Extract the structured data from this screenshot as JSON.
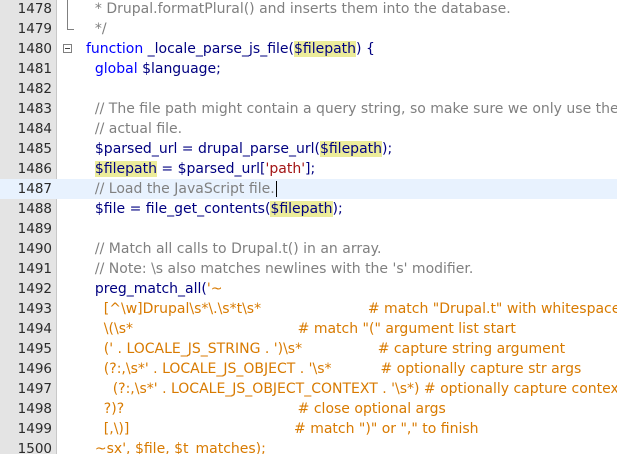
{
  "lines": [
    {
      "num": "1478",
      "tokens": [
        {
          "t": "  * Drupal.formatPlural() and inserts them into the database.",
          "c": "t-cmt"
        }
      ]
    },
    {
      "num": "1479",
      "tokens": [
        {
          "t": "  */",
          "c": "t-cmt"
        }
      ]
    },
    {
      "num": "1480",
      "tokens": [
        {
          "t": "function",
          "c": "t-kw"
        },
        {
          "t": " _locale_parse_js_file(",
          "c": "t-fn"
        },
        {
          "t": "$filepath",
          "c": "t-hl"
        },
        {
          "t": ") {",
          "c": "t-fn"
        }
      ]
    },
    {
      "num": "1481",
      "tokens": [
        {
          "t": "  global ",
          "c": "t-kw"
        },
        {
          "t": "$language;",
          "c": "t-var"
        }
      ]
    },
    {
      "num": "1482",
      "tokens": []
    },
    {
      "num": "1483",
      "tokens": [
        {
          "t": "  // The file path might contain a query string, so make sure we only use the",
          "c": "t-cmt"
        }
      ]
    },
    {
      "num": "1484",
      "tokens": [
        {
          "t": "  // actual file.",
          "c": "t-cmt"
        }
      ]
    },
    {
      "num": "1485",
      "tokens": [
        {
          "t": "  $parsed_url = drupal_parse_url(",
          "c": "t-var"
        },
        {
          "t": "$filepath",
          "c": "t-hl"
        },
        {
          "t": ");",
          "c": "t-var"
        }
      ]
    },
    {
      "num": "1486",
      "tokens": [
        {
          "t": "  ",
          "c": "t-var"
        },
        {
          "t": "$filepath",
          "c": "t-hl"
        },
        {
          "t": " = $parsed_url[",
          "c": "t-var"
        },
        {
          "t": "'path'",
          "c": "t-str"
        },
        {
          "t": "];",
          "c": "t-var"
        }
      ]
    },
    {
      "num": "1487",
      "tokens": [
        {
          "t": "  // Load the JavaScript file.",
          "c": "t-cmt"
        }
      ],
      "current": true
    },
    {
      "num": "1488",
      "tokens": [
        {
          "t": "  $file = file_get_contents(",
          "c": "t-var"
        },
        {
          "t": "$filepath",
          "c": "t-hl"
        },
        {
          "t": ");",
          "c": "t-var"
        }
      ]
    },
    {
      "num": "1489",
      "tokens": []
    },
    {
      "num": "1490",
      "tokens": [
        {
          "t": "  // Match all calls to Drupal.t() in an array.",
          "c": "t-cmt"
        }
      ]
    },
    {
      "num": "1491",
      "tokens": [
        {
          "t": "  // Note: \\s also matches newlines with the 's' modifier.",
          "c": "t-cmt"
        }
      ]
    },
    {
      "num": "1492",
      "tokens": [
        {
          "t": "  preg_match_all(",
          "c": "t-fn"
        },
        {
          "t": "'~",
          "c": "t-regex"
        }
      ]
    },
    {
      "num": "1493",
      "tokens": [
        {
          "t": "    [^\\w]Drupal\\s*\\.\\s*t\\s*                        # match \"Drupal.t\" with whitespace",
          "c": "t-regex"
        }
      ]
    },
    {
      "num": "1494",
      "tokens": [
        {
          "t": "    \\(\\s*                                     # match \"(\" argument list start",
          "c": "t-regex"
        }
      ]
    },
    {
      "num": "1495",
      "tokens": [
        {
          "t": "    (' . LOCALE_JS_STRING . ')\\s*                 # capture string argument",
          "c": "t-regex"
        }
      ]
    },
    {
      "num": "1496",
      "tokens": [
        {
          "t": "    (?:,\\s*' . LOCALE_JS_OBJECT . '\\s*           # optionally capture str args",
          "c": "t-regex"
        }
      ]
    },
    {
      "num": "1497",
      "tokens": [
        {
          "t": "      (?:,\\s*' . LOCALE_JS_OBJECT_CONTEXT . '\\s*) # optionally capture context",
          "c": "t-regex"
        }
      ]
    },
    {
      "num": "1498",
      "tokens": [
        {
          "t": "    ?)?                                       # close optional args",
          "c": "t-regex"
        }
      ]
    },
    {
      "num": "1499",
      "tokens": [
        {
          "t": "    [,\\)]                                     # match \")\" or \",\" to finish",
          "c": "t-regex"
        }
      ]
    },
    {
      "num": "1500",
      "tokens": [
        {
          "t": "  ~sx', $file, $t_matches);",
          "c": "t-regex"
        }
      ]
    }
  ]
}
